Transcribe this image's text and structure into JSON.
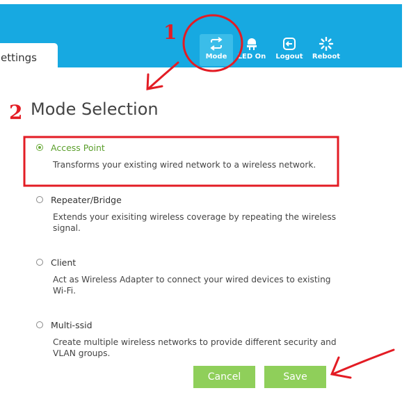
{
  "header": {
    "settings_tab": "ettings",
    "nav": [
      {
        "label": "Mode",
        "icon": "mode-switch-icon"
      },
      {
        "label": "LED On",
        "icon": "led-bulb-icon"
      },
      {
        "label": "Logout",
        "icon": "logout-icon"
      },
      {
        "label": "Reboot",
        "icon": "reboot-icon"
      }
    ]
  },
  "main": {
    "title": "Mode Selection",
    "options": [
      {
        "label": "Access Point",
        "description": "Transforms your existing wired network to a wireless network.",
        "selected": true
      },
      {
        "label": "Repeater/Bridge",
        "description": "Extends your exisiting wireless coverage by repeating the wireless signal.",
        "selected": false
      },
      {
        "label": "Client",
        "description": "Act as Wireless Adapter to connect your wired devices to existing Wi-Fi.",
        "selected": false
      },
      {
        "label": "Multi-ssid",
        "description": "Create multiple wireless networks to provide different security and VLAN groups.",
        "selected": false
      }
    ],
    "cancel_label": "Cancel",
    "save_label": "Save"
  },
  "annotations": {
    "step1": "1",
    "step2": "2"
  },
  "colors": {
    "header_bg": "#17a9e1",
    "accent_green": "#8fcf5a",
    "selected_text": "#5b9f2c",
    "annotation_red": "#e31c24"
  }
}
